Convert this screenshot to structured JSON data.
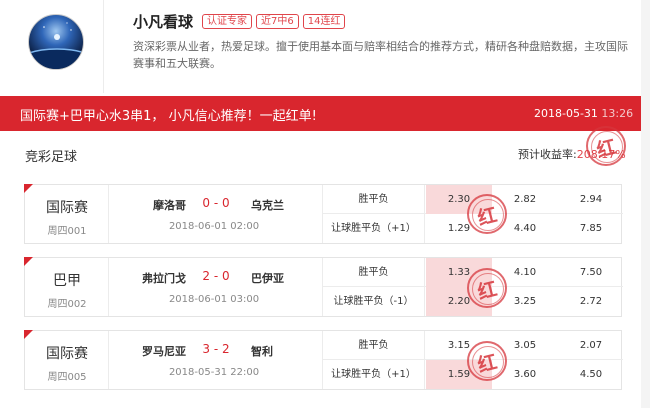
{
  "expert": {
    "name": "小凡看球",
    "tags": [
      "认证专家",
      "近7中6",
      "14连红"
    ],
    "description": "资深彩票从业者，热爱足球。擅于使用基本面与赔率相结合的推荐方式，精研各种盘赔数据，主攻国际赛事和五大联赛。"
  },
  "banner": {
    "title": "国际赛+巴甲心水3串1， 小凡信心推荐！一起红单!",
    "date_visible": "2018-05-31",
    "date_rest": " 13:26"
  },
  "section": {
    "title": "竞彩足球",
    "yield_label": "预计收益率:",
    "yield_value": "208.17%"
  },
  "stamp_text": "红",
  "matches": [
    {
      "league": "国际赛",
      "match_no": "周四001",
      "home": "摩洛哥",
      "score": "0 - 0",
      "away": "乌克兰",
      "kickoff": "2018-06-01 02:00",
      "rows": [
        {
          "type": "胜平负",
          "odds": [
            "2.30",
            "2.82",
            "2.94"
          ],
          "highlight": 0
        },
        {
          "type": "让球胜平负（+1）",
          "odds": [
            "1.29",
            "4.40",
            "7.85"
          ],
          "highlight": -1
        }
      ]
    },
    {
      "league": "巴甲",
      "match_no": "周四002",
      "home": "弗拉门戈",
      "score": "2 - 0",
      "away": "巴伊亚",
      "kickoff": "2018-06-01 03:00",
      "rows": [
        {
          "type": "胜平负",
          "odds": [
            "1.33",
            "4.10",
            "7.50"
          ],
          "highlight": 0
        },
        {
          "type": "让球胜平负（-1）",
          "odds": [
            "2.20",
            "3.25",
            "2.72"
          ],
          "highlight": 0
        }
      ]
    },
    {
      "league": "国际赛",
      "match_no": "周四005",
      "home": "罗马尼亚",
      "score": "3 - 2",
      "away": "智利",
      "kickoff": "2018-05-31 22:00",
      "rows": [
        {
          "type": "胜平负",
          "odds": [
            "3.15",
            "3.05",
            "2.07"
          ],
          "highlight": -1
        },
        {
          "type": "让球胜平负（+1）",
          "odds": [
            "1.59",
            "3.60",
            "4.50"
          ],
          "highlight": 0
        }
      ]
    }
  ]
}
